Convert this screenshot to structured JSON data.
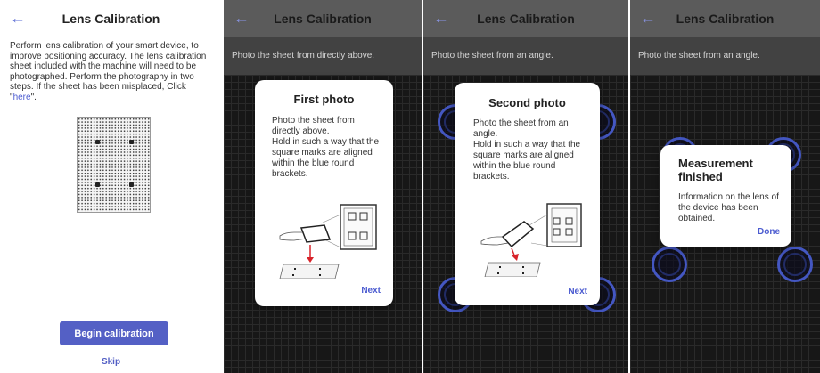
{
  "screen1": {
    "back_icon": "arrow-left-icon",
    "title": "Lens Calibration",
    "description_pre": "Perform lens calibration of your smart device, to improve positioning accuracy. The lens calibration sheet included with the machine will need to be photographed. Perform the photography in two steps. If the sheet has been misplaced, Click \"",
    "here_link": "here",
    "description_post": "\".",
    "begin_button": "Begin calibration",
    "skip_link": "Skip"
  },
  "screen2": {
    "back_icon": "arrow-left-icon",
    "title": "Lens Calibration",
    "instruction": "Photo the sheet from directly above.",
    "card": {
      "title": "First photo",
      "body": "Photo the sheet from directly above.\nHold in such a way that the square marks are aligned within the blue round brackets.",
      "next": "Next"
    }
  },
  "screen3": {
    "back_icon": "arrow-left-icon",
    "title": "Lens Calibration",
    "instruction": "Photo the sheet from an angle.",
    "card": {
      "title": "Second photo",
      "body": "Photo the sheet from an angle.\nHold in such a way that the square marks are aligned within the blue round brackets.",
      "next": "Next"
    }
  },
  "screen4": {
    "back_icon": "arrow-left-icon",
    "title": "Lens Calibration",
    "instruction": "Photo the sheet from an angle.",
    "dialog": {
      "title": "Measurement finished",
      "body": "Information on the lens of the device has been obtained.",
      "done": "Done"
    }
  },
  "colors": {
    "accent": "#5460c5",
    "ring": "#4457c2",
    "dark_bar": "#5b5b5b",
    "instruction_bar": "#424242"
  }
}
